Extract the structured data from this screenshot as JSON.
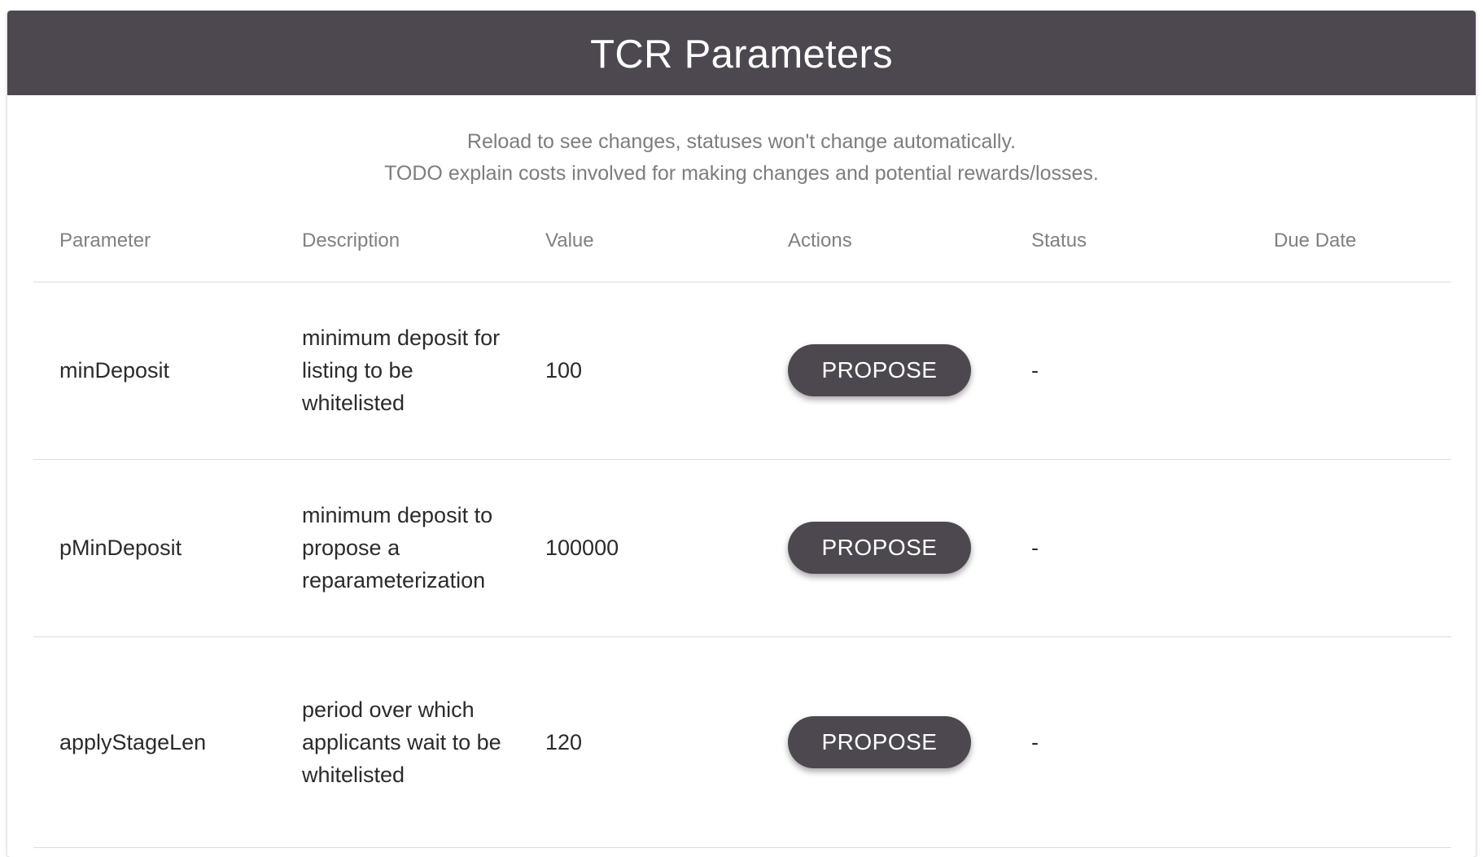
{
  "header": {
    "title": "TCR Parameters"
  },
  "notes": {
    "line1": "Reload to see changes, statuses won't change automatically.",
    "line2": "TODO explain costs involved for making changes and potential rewards/losses."
  },
  "table": {
    "columns": [
      "Parameter",
      "Description",
      "Value",
      "Actions",
      "Status",
      "Due Date"
    ],
    "rows": [
      {
        "parameter": "minDeposit",
        "description": "minimum deposit for listing to be whitelisted",
        "value": "100",
        "action_label": "PROPOSE",
        "status": "-",
        "due_date": ""
      },
      {
        "parameter": "pMinDeposit",
        "description": "minimum deposit to propose a reparameterization",
        "value": "100000",
        "action_label": "PROPOSE",
        "status": "-",
        "due_date": ""
      },
      {
        "parameter": "applyStageLen",
        "description": "period over which applicants wait to be whitelisted",
        "value": "120",
        "action_label": "PROPOSE",
        "status": "-",
        "due_date": ""
      }
    ]
  },
  "colors": {
    "header_bg": "#4d4850",
    "button_bg": "#4d4850",
    "muted_text": "#7d7d7d"
  }
}
